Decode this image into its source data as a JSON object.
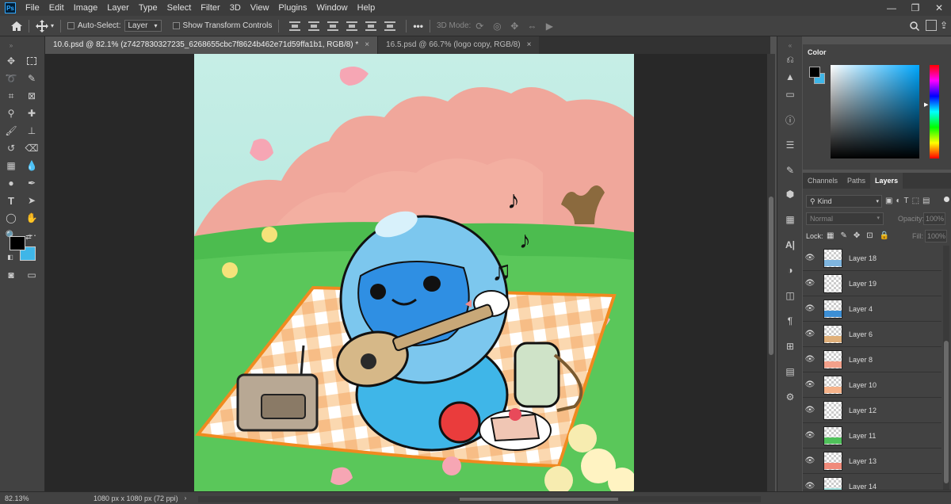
{
  "menu": [
    "File",
    "Edit",
    "Image",
    "Layer",
    "Type",
    "Select",
    "Filter",
    "3D",
    "View",
    "Plugins",
    "Window",
    "Help"
  ],
  "app_logo": "Ps",
  "window_controls": {
    "minimize": "—",
    "restore": "❐",
    "close": "✕"
  },
  "options_bar": {
    "auto_select_label": "Auto-Select:",
    "auto_select_target": "Layer",
    "show_transform_label": "Show Transform Controls",
    "more": "•••",
    "mode_3d_label": "3D Mode:"
  },
  "tabs": [
    {
      "label": "10.6.psd @ 82.1% (z7427830327235_6268655cbc7f8624b462e71d59ffa1b1, RGB/8) *",
      "active": true,
      "close": "×"
    },
    {
      "label": "16.5.psd @ 66.7% (logo copy, RGB/8)",
      "active": false,
      "close": "×"
    }
  ],
  "status": {
    "zoom": "82.13%",
    "doc_info": "1080 px x 1080 px (72 ppi)"
  },
  "color_panel": {
    "title": "Color",
    "fg": "#000000",
    "bg": "#3fb6e8"
  },
  "layers_panel": {
    "tabs": [
      "Channels",
      "Paths",
      "Layers"
    ],
    "active_tab": "Layers",
    "kind_label": "Kind",
    "blend_mode": "Normal",
    "opacity_label": "Opacity:",
    "opacity_value": "100%",
    "lock_label": "Lock:",
    "fill_label": "Fill:",
    "fill_value": "100%",
    "layers": [
      {
        "name": "Layer 18",
        "thumb": "#7fb6e0"
      },
      {
        "name": "Layer 19",
        "thumb": ""
      },
      {
        "name": "Layer 4",
        "thumb": "#3c8fd6"
      },
      {
        "name": "Layer 6",
        "thumb": "#e0b07a"
      },
      {
        "name": "Layer 8",
        "thumb": "#f3a08a"
      },
      {
        "name": "Layer 10",
        "thumb": "#f6b38a"
      },
      {
        "name": "Layer 12",
        "thumb": ""
      },
      {
        "name": "Layer 11",
        "thumb": "#4fc15a"
      },
      {
        "name": "Layer 13",
        "thumb": "#f08a7a"
      },
      {
        "name": "Layer 14",
        "thumb": "#a5e4e0"
      }
    ]
  },
  "music_notes": [
    "♪",
    "♪",
    "♫"
  ]
}
